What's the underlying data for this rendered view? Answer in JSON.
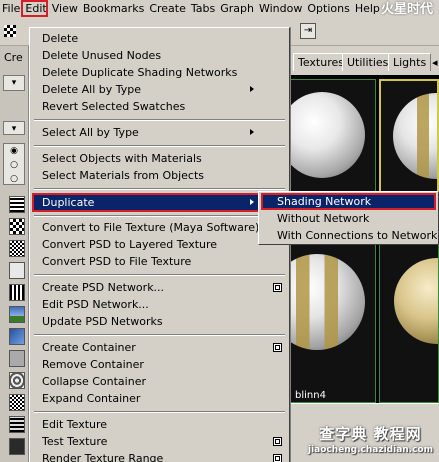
{
  "menubar": {
    "items": [
      "File",
      "Edit",
      "View",
      "Bookmarks",
      "Create",
      "Tabs",
      "Graph",
      "Window",
      "Options",
      "Help"
    ]
  },
  "background": {
    "left_label": "Cre",
    "tabs": [
      "Textures",
      "Utilities",
      "Lights"
    ],
    "swatch_label": "blinn4",
    "logo": "火星时代",
    "watermark_cn": "查字典 教程网",
    "watermark_url": "jiaocheng.chazidian.com"
  },
  "edit_menu": {
    "items": [
      {
        "label": "Delete"
      },
      {
        "label": "Delete Unused Nodes"
      },
      {
        "label": "Delete Duplicate Shading Networks"
      },
      {
        "label": "Delete All by Type",
        "submenu": true
      },
      {
        "label": "Revert Selected Swatches"
      },
      {
        "label": "Select All by Type",
        "submenu": true
      },
      {
        "label": "Select Objects with Materials"
      },
      {
        "label": "Select Materials from Objects"
      },
      {
        "label": "Duplicate",
        "submenu": true,
        "active": true
      },
      {
        "label": "Convert to File Texture (Maya Software)",
        "option_box": true
      },
      {
        "label": "Convert PSD to Layered Texture"
      },
      {
        "label": "Convert PSD to File Texture"
      },
      {
        "label": "Create PSD Network...",
        "option_box": true
      },
      {
        "label": "Edit PSD Network..."
      },
      {
        "label": "Update PSD Networks"
      },
      {
        "label": "Create Container",
        "option_box": true
      },
      {
        "label": "Remove Container"
      },
      {
        "label": "Collapse Container"
      },
      {
        "label": "Expand Container"
      },
      {
        "label": "Edit Texture"
      },
      {
        "label": "Test Texture",
        "option_box": true
      },
      {
        "label": "Render Texture Range",
        "option_box": true
      }
    ]
  },
  "duplicate_submenu": {
    "items": [
      {
        "label": "Shading Network",
        "active": true
      },
      {
        "label": "Without Network"
      },
      {
        "label": "With Connections to Network"
      }
    ]
  },
  "colors": {
    "menu_bg": "#d4d0c8",
    "highlight": "#0a246a",
    "annotation_red": "#d51e27"
  }
}
